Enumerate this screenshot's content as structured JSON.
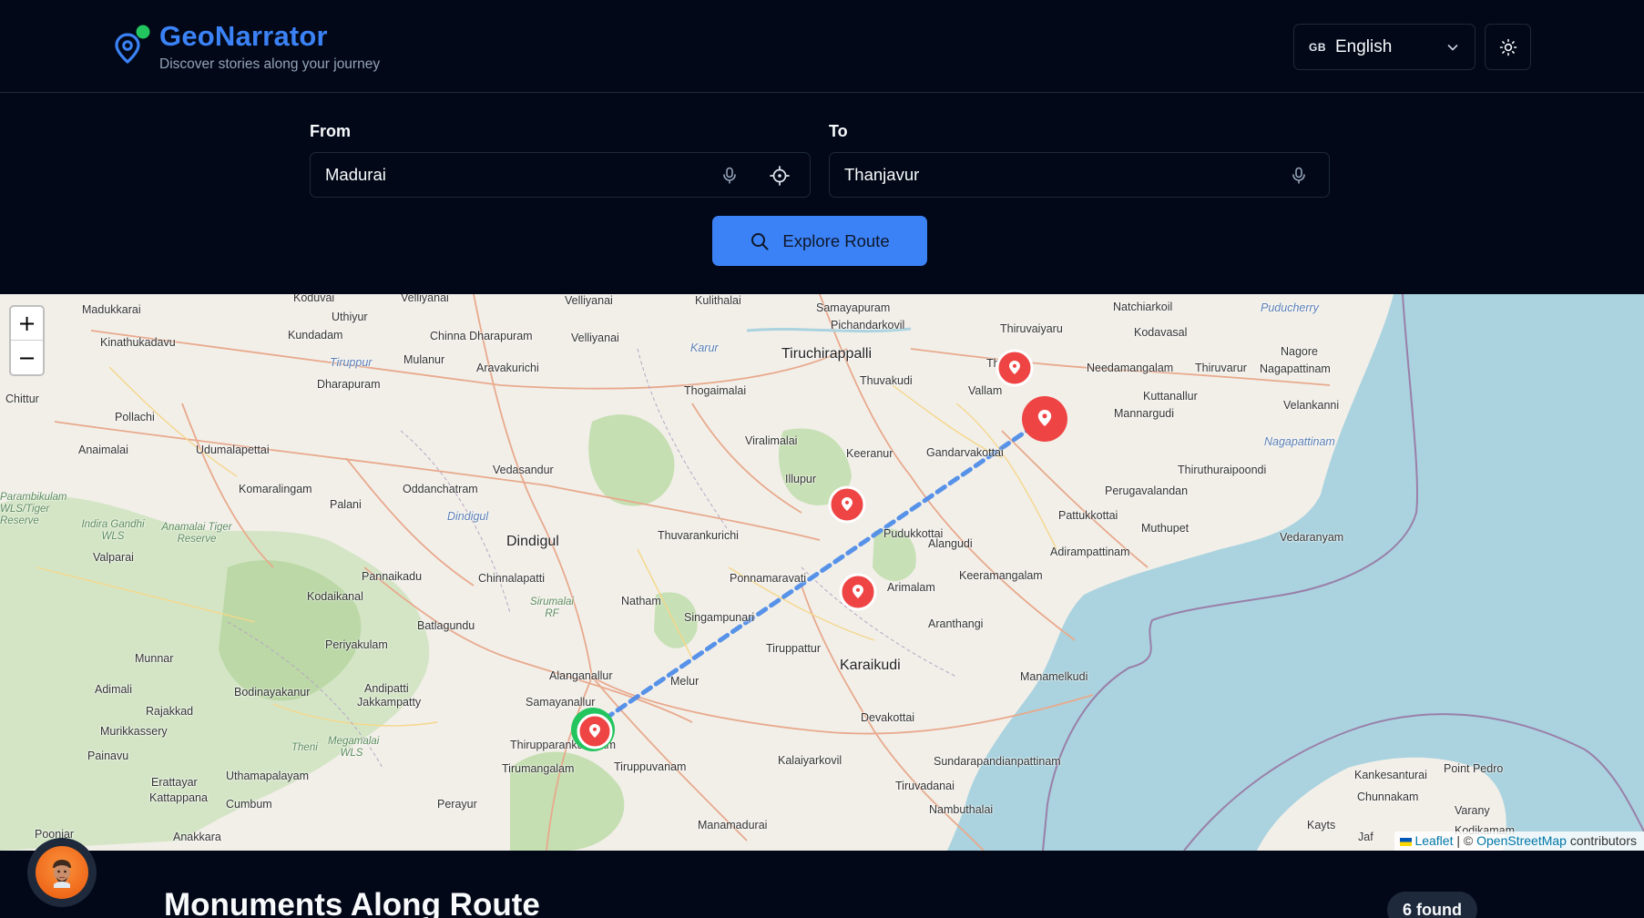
{
  "app": {
    "title": "GeoNarrator",
    "subtitle": "Discover stories along your journey",
    "logo_icon": "map-pin-icon",
    "accent": "#3b82f6"
  },
  "header": {
    "language": {
      "flag": "GB",
      "selected": "English"
    },
    "theme_icon": "sun-icon"
  },
  "route_form": {
    "from_label": "From",
    "from_value": "Madurai",
    "to_label": "To",
    "to_value": "Thanjavur",
    "explore_label": "Explore Route"
  },
  "map": {
    "zoom_in": "+",
    "zoom_out": "−",
    "attribution": {
      "leaflet": "Leaflet",
      "separator": " | © ",
      "osm": "OpenStreetMap",
      "suffix": " contributors"
    },
    "route_color": "#4a8ae8",
    "marker_color": "#ef4444",
    "start_color": "#22c55e",
    "places": {
      "tiruchirappalli": "Tiruchirappalli",
      "dindigul": "Dindigul",
      "karaikudi": "Karaikudi",
      "madurai_partial": "Ma   i",
      "thanjavur_partial": "Th        ur",
      "pudukkottai": "Pudukkottai",
      "samayapuram": "Samayapuram",
      "pichandarkovil": "Pichandarkovil",
      "thiruvaiyaru": "Thiruvaiyaru",
      "natchiarkoil": "Natchiarkoil",
      "puducherry": "Puducherry",
      "kodavasal": "Kodavasal",
      "nagore": "Nagore",
      "needamangalam": "Needamangalam",
      "thiruvarur": "Thiruvarur",
      "nagapattinam": "Nagapattinam",
      "thuvakudi": "Thuvakudi",
      "vallam": "Vallam",
      "kuttanallur": "Kuttanallur",
      "mannargudi": "Mannargudi",
      "velankanni": "Velankanni",
      "nagapattinam2": "Nagapattinam",
      "thiruthuraipoondi": "Thiruthuraipoondi",
      "vedaranyam": "Vedaranyam",
      "perugavalandan": "Perugavalandan",
      "pattukkottai": "Pattukkottai",
      "muthupet": "Muthupet",
      "adirampattinam": "Adirampattinam",
      "alangudi": "Alangudi",
      "keeramangalam": "Keeramangalam",
      "gandarvakottai": "Gandarvakottai",
      "keeranur": "Keeranur",
      "viralimalai": "Viralimalai",
      "illupur": "Illupur",
      "thogaimalai": "Thogaimalai",
      "kulithalai": "Kulithalai",
      "karur": "Karur",
      "velliyanai": "Velliyanai",
      "chinna_dharapuram": "Chinna Dharapuram",
      "aravakurichi": "Aravakurichi",
      "koduvai": "Koduvai",
      "uthiyur": "Uthiyur",
      "kundadam": "Kundadam",
      "madukkarai": "Madukkarai",
      "kinathukadavu": "Kinathukadavu",
      "tiruppur": "Tiruppur",
      "mulanur": "Mulanur",
      "dharapuram": "Dharapuram",
      "pollachi": "Pollachi",
      "chittur": "Chittur",
      "anaimalai": "Anaimalai",
      "udumalapettai": "Udumalapettai",
      "komaralingam": "Komaralingam",
      "oddanchatram": "Oddanchatram",
      "vedasandur": "Vedasandur",
      "palani": "Palani",
      "dindigul_dist": "Dindigul",
      "thuvarankurichi": "Thuvarankurichi",
      "ponnamaravati": "Ponnamaravati",
      "arimalam": "Arimalam",
      "aranthangi": "Aranthangi",
      "singampunari": "Singampunari",
      "natham": "Natham",
      "chinnalapatti": "Chinnalapatti",
      "pannaikadu": "Pannaikadu",
      "kodaikanal": "Kodaikanal",
      "batlagundu": "Batlagundu",
      "sirumalai": "Sirumalai RF",
      "periyakulam": "Periyakulam",
      "munnar": "Munnar",
      "adimali": "Adimali",
      "bodinayakanur": "Bodinayakanur",
      "andipatti": "Andipatti",
      "jakkampatty": "Jakkampatty",
      "alanganallur": "Alanganallur",
      "melur": "Melur",
      "tiruppattur": "Tiruppattur",
      "manamelkudi": "Manamelkudi",
      "devakottai": "Devakottai",
      "samayanallur": "Samayanallur",
      "thirupparankundram": "Thirupparankundram",
      "tirumangalam": "Tirumangalam",
      "tiruppuvanam": "Tiruppuvanam",
      "kalaiyarkovil": "Kalaiyarkovil",
      "sundarapandianpattinam": "Sundarapandianpattinam",
      "tiruvadanai": "Tiruvadanai",
      "nambuthalai": "Nambuthalai",
      "manamadurai": "Manamadurai",
      "perayur": "Perayur",
      "rajakkad": "Rajakkad",
      "murikkassery": "Murikkassery",
      "painavu": "Painavu",
      "erattayar": "Erattayar",
      "kattappana": "Kattappana",
      "uthamapalayam": "Uthamapalayam",
      "cumbum": "Cumbum",
      "theni": "Theni",
      "megamalai": "Megamalai WLS",
      "anakkara": "Anakkara",
      "poonjar": "Poonjar",
      "valparai": "Valparai",
      "indira_gandhi": "Indira Gandhi WLS",
      "anamalai_tiger": "Anamalai Tiger Reserve",
      "parambikulam": "Parambikulam WLS/Tiger Reserve",
      "kankesanturai": "Kankesanturai",
      "point_pedro": "Point Pedro",
      "chunnakam": "Chunnakam",
      "varany": "Varany",
      "kayts": "Kayts",
      "jaffna_partial": "Jaf",
      "kodikamam": "Kodikamam"
    }
  },
  "monuments": {
    "title": "Monuments Along Route",
    "count_label": "6 found"
  },
  "assistant": {
    "avatar_icon": "guide-avatar-icon"
  }
}
